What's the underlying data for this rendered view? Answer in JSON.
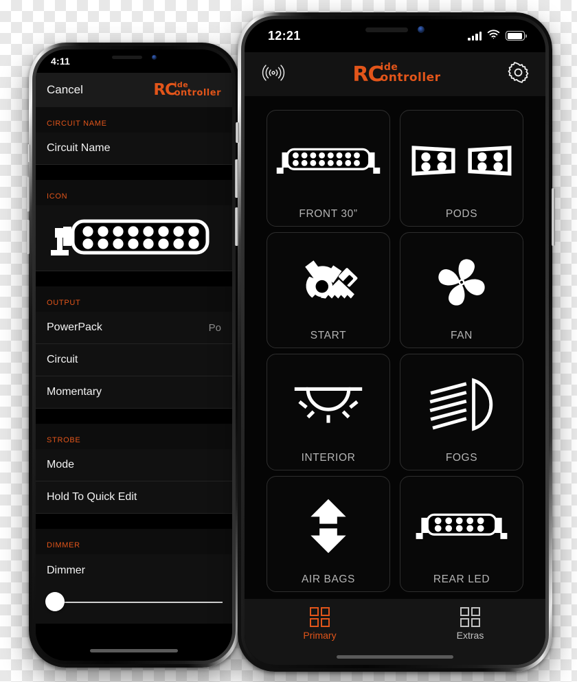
{
  "app": {
    "logo": {
      "rc": "RC",
      "ide": "ide",
      "ontroller": "ontroller"
    },
    "accent_orange": "#E2551A",
    "label_gray": "#b4b4b4"
  },
  "left_phone": {
    "statusbar": {
      "time": "4:11"
    },
    "navbar": {
      "cancel_label": "Cancel"
    },
    "sections": [
      {
        "header": "CIRCUIT NAME",
        "rows": [
          {
            "label": "Circuit Name",
            "value": ""
          }
        ]
      },
      {
        "header": "ICON",
        "icon_name": "led-light-bar-icon"
      },
      {
        "header": "OUTPUT",
        "rows": [
          {
            "label": "PowerPack",
            "value": "Po"
          },
          {
            "label": "Circuit",
            "value": ""
          },
          {
            "label": "Momentary",
            "value": ""
          }
        ]
      },
      {
        "header": "STROBE",
        "rows": [
          {
            "label": "Mode",
            "value": ""
          },
          {
            "label": "Hold To Quick Edit",
            "value": ""
          }
        ]
      },
      {
        "header": "DIMMER",
        "rows": [
          {
            "label": "Dimmer",
            "value": ""
          }
        ],
        "slider": {
          "value": 0
        }
      }
    ]
  },
  "right_phone": {
    "statusbar": {
      "time": "12:21",
      "signal_icon": "cellular-signal-icon",
      "wifi_icon": "wifi-icon",
      "battery_icon": "battery-icon"
    },
    "appbar": {
      "left_icon": "broadcast-signal-icon",
      "right_icon": "gear-icon"
    },
    "tiles": [
      {
        "label": "FRONT 30”",
        "icon": "led-light-bar-icon"
      },
      {
        "label": "PODS",
        "icon": "led-pods-icon"
      },
      {
        "label": "START",
        "icon": "ignition-key-icon"
      },
      {
        "label": "FAN",
        "icon": "fan-icon"
      },
      {
        "label": "INTERIOR",
        "icon": "dome-light-icon"
      },
      {
        "label": "FOGS",
        "icon": "fog-light-icon"
      },
      {
        "label": "AIR BAGS",
        "icon": "up-down-arrows-icon"
      },
      {
        "label": "REAR LED",
        "icon": "rear-led-bar-icon"
      }
    ],
    "tabs": [
      {
        "label": "Primary",
        "icon": "grid-icon",
        "active": true
      },
      {
        "label": "Extras",
        "icon": "grid-icon",
        "active": false
      }
    ]
  }
}
